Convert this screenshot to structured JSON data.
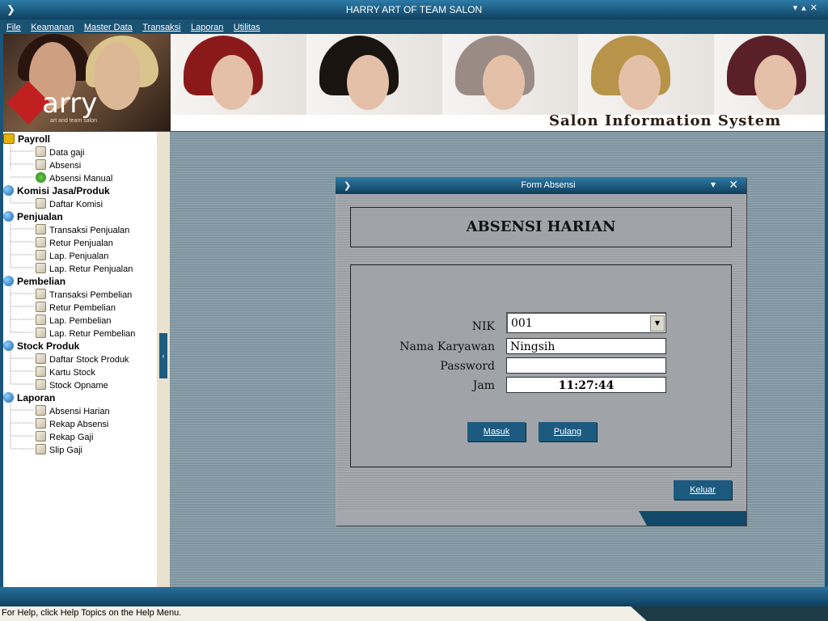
{
  "window": {
    "title": "HARRY ART OF TEAM SALON"
  },
  "menu": [
    {
      "label": "File"
    },
    {
      "label": "Keamanan"
    },
    {
      "label": "Master Data"
    },
    {
      "label": "Transaksi"
    },
    {
      "label": "Laporan"
    },
    {
      "label": "Utilitas"
    }
  ],
  "banner": {
    "logo_text": "arry",
    "logo_tagline": "art and team salon",
    "system_title": "Salon Information System"
  },
  "sidebar": {
    "groups": [
      {
        "label": "Payroll",
        "icon": "folder-icon",
        "items": [
          {
            "label": "Data gaji",
            "icon": "document-icon"
          },
          {
            "label": "Absensi",
            "icon": "document-icon"
          },
          {
            "label": "Absensi Manual",
            "icon": "green-refresh-icon"
          }
        ]
      },
      {
        "label": "Komisi Jasa/Produk",
        "icon": "globe-icon",
        "items": [
          {
            "label": "Daftar Komisi",
            "icon": "document-icon"
          }
        ]
      },
      {
        "label": "Penjualan",
        "icon": "globe-icon",
        "items": [
          {
            "label": "Transaksi Penjualan",
            "icon": "document-icon"
          },
          {
            "label": "Retur Penjualan",
            "icon": "document-icon"
          },
          {
            "label": "Lap. Penjualan",
            "icon": "document-icon"
          },
          {
            "label": "Lap. Retur Penjualan",
            "icon": "document-icon"
          }
        ]
      },
      {
        "label": "Pembelian",
        "icon": "globe-icon",
        "items": [
          {
            "label": "Transaksi Pembelian",
            "icon": "document-icon"
          },
          {
            "label": "Retur Pembelian",
            "icon": "document-icon"
          },
          {
            "label": "Lap. Pembelian",
            "icon": "document-icon"
          },
          {
            "label": "Lap. Retur Pembelian",
            "icon": "document-icon"
          }
        ]
      },
      {
        "label": "Stock Produk",
        "icon": "globe-icon",
        "items": [
          {
            "label": "Daftar Stock Produk",
            "icon": "document-icon"
          },
          {
            "label": "Kartu Stock",
            "icon": "document-icon"
          },
          {
            "label": "Stock Opname",
            "icon": "document-icon"
          }
        ]
      },
      {
        "label": "Laporan",
        "icon": "globe-icon",
        "items": [
          {
            "label": "Absensi Harian",
            "icon": "document-icon"
          },
          {
            "label": "Rekap Absensi",
            "icon": "document-icon"
          },
          {
            "label": "Rekap Gaji",
            "icon": "document-icon"
          },
          {
            "label": "Slip Gaji",
            "icon": "document-icon"
          }
        ]
      }
    ]
  },
  "dialog": {
    "title": "Form Absensi",
    "heading": "ABSENSI HARIAN",
    "fields": {
      "nik": {
        "label": "NIK",
        "value": "001"
      },
      "nama": {
        "label": "Nama Karyawan",
        "value": "Ningsih"
      },
      "password": {
        "label": "Password",
        "value": ""
      },
      "jam": {
        "label": "Jam",
        "value": "11:27:44"
      }
    },
    "buttons": {
      "masuk": "Masuk",
      "pulang": "Pulang",
      "keluar": "Keluar"
    }
  },
  "statusbar": {
    "text": "For Help, click Help Topics on the Help Menu."
  },
  "colors": {
    "titlebar": "#1a5a82",
    "workspace": "#8a9ea8",
    "button": "#1c5a80",
    "dialog": "#a4a8ac"
  }
}
